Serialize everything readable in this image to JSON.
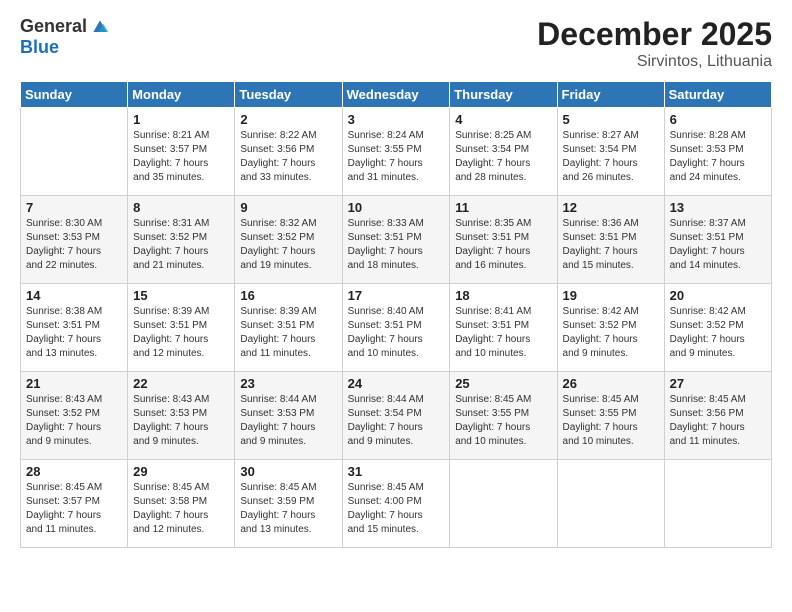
{
  "logo": {
    "general": "General",
    "blue": "Blue"
  },
  "title": "December 2025",
  "subtitle": "Sirvintos, Lithuania",
  "weekdays": [
    "Sunday",
    "Monday",
    "Tuesday",
    "Wednesday",
    "Thursday",
    "Friday",
    "Saturday"
  ],
  "weeks": [
    [
      {
        "day": "",
        "info": ""
      },
      {
        "day": "1",
        "info": "Sunrise: 8:21 AM\nSunset: 3:57 PM\nDaylight: 7 hours\nand 35 minutes."
      },
      {
        "day": "2",
        "info": "Sunrise: 8:22 AM\nSunset: 3:56 PM\nDaylight: 7 hours\nand 33 minutes."
      },
      {
        "day": "3",
        "info": "Sunrise: 8:24 AM\nSunset: 3:55 PM\nDaylight: 7 hours\nand 31 minutes."
      },
      {
        "day": "4",
        "info": "Sunrise: 8:25 AM\nSunset: 3:54 PM\nDaylight: 7 hours\nand 28 minutes."
      },
      {
        "day": "5",
        "info": "Sunrise: 8:27 AM\nSunset: 3:54 PM\nDaylight: 7 hours\nand 26 minutes."
      },
      {
        "day": "6",
        "info": "Sunrise: 8:28 AM\nSunset: 3:53 PM\nDaylight: 7 hours\nand 24 minutes."
      }
    ],
    [
      {
        "day": "7",
        "info": "Sunrise: 8:30 AM\nSunset: 3:53 PM\nDaylight: 7 hours\nand 22 minutes."
      },
      {
        "day": "8",
        "info": "Sunrise: 8:31 AM\nSunset: 3:52 PM\nDaylight: 7 hours\nand 21 minutes."
      },
      {
        "day": "9",
        "info": "Sunrise: 8:32 AM\nSunset: 3:52 PM\nDaylight: 7 hours\nand 19 minutes."
      },
      {
        "day": "10",
        "info": "Sunrise: 8:33 AM\nSunset: 3:51 PM\nDaylight: 7 hours\nand 18 minutes."
      },
      {
        "day": "11",
        "info": "Sunrise: 8:35 AM\nSunset: 3:51 PM\nDaylight: 7 hours\nand 16 minutes."
      },
      {
        "day": "12",
        "info": "Sunrise: 8:36 AM\nSunset: 3:51 PM\nDaylight: 7 hours\nand 15 minutes."
      },
      {
        "day": "13",
        "info": "Sunrise: 8:37 AM\nSunset: 3:51 PM\nDaylight: 7 hours\nand 14 minutes."
      }
    ],
    [
      {
        "day": "14",
        "info": "Sunrise: 8:38 AM\nSunset: 3:51 PM\nDaylight: 7 hours\nand 13 minutes."
      },
      {
        "day": "15",
        "info": "Sunrise: 8:39 AM\nSunset: 3:51 PM\nDaylight: 7 hours\nand 12 minutes."
      },
      {
        "day": "16",
        "info": "Sunrise: 8:39 AM\nSunset: 3:51 PM\nDaylight: 7 hours\nand 11 minutes."
      },
      {
        "day": "17",
        "info": "Sunrise: 8:40 AM\nSunset: 3:51 PM\nDaylight: 7 hours\nand 10 minutes."
      },
      {
        "day": "18",
        "info": "Sunrise: 8:41 AM\nSunset: 3:51 PM\nDaylight: 7 hours\nand 10 minutes."
      },
      {
        "day": "19",
        "info": "Sunrise: 8:42 AM\nSunset: 3:52 PM\nDaylight: 7 hours\nand 9 minutes."
      },
      {
        "day": "20",
        "info": "Sunrise: 8:42 AM\nSunset: 3:52 PM\nDaylight: 7 hours\nand 9 minutes."
      }
    ],
    [
      {
        "day": "21",
        "info": "Sunrise: 8:43 AM\nSunset: 3:52 PM\nDaylight: 7 hours\nand 9 minutes."
      },
      {
        "day": "22",
        "info": "Sunrise: 8:43 AM\nSunset: 3:53 PM\nDaylight: 7 hours\nand 9 minutes."
      },
      {
        "day": "23",
        "info": "Sunrise: 8:44 AM\nSunset: 3:53 PM\nDaylight: 7 hours\nand 9 minutes."
      },
      {
        "day": "24",
        "info": "Sunrise: 8:44 AM\nSunset: 3:54 PM\nDaylight: 7 hours\nand 9 minutes."
      },
      {
        "day": "25",
        "info": "Sunrise: 8:45 AM\nSunset: 3:55 PM\nDaylight: 7 hours\nand 10 minutes."
      },
      {
        "day": "26",
        "info": "Sunrise: 8:45 AM\nSunset: 3:55 PM\nDaylight: 7 hours\nand 10 minutes."
      },
      {
        "day": "27",
        "info": "Sunrise: 8:45 AM\nSunset: 3:56 PM\nDaylight: 7 hours\nand 11 minutes."
      }
    ],
    [
      {
        "day": "28",
        "info": "Sunrise: 8:45 AM\nSunset: 3:57 PM\nDaylight: 7 hours\nand 11 minutes."
      },
      {
        "day": "29",
        "info": "Sunrise: 8:45 AM\nSunset: 3:58 PM\nDaylight: 7 hours\nand 12 minutes."
      },
      {
        "day": "30",
        "info": "Sunrise: 8:45 AM\nSunset: 3:59 PM\nDaylight: 7 hours\nand 13 minutes."
      },
      {
        "day": "31",
        "info": "Sunrise: 8:45 AM\nSunset: 4:00 PM\nDaylight: 7 hours\nand 15 minutes."
      },
      {
        "day": "",
        "info": ""
      },
      {
        "day": "",
        "info": ""
      },
      {
        "day": "",
        "info": ""
      }
    ]
  ]
}
